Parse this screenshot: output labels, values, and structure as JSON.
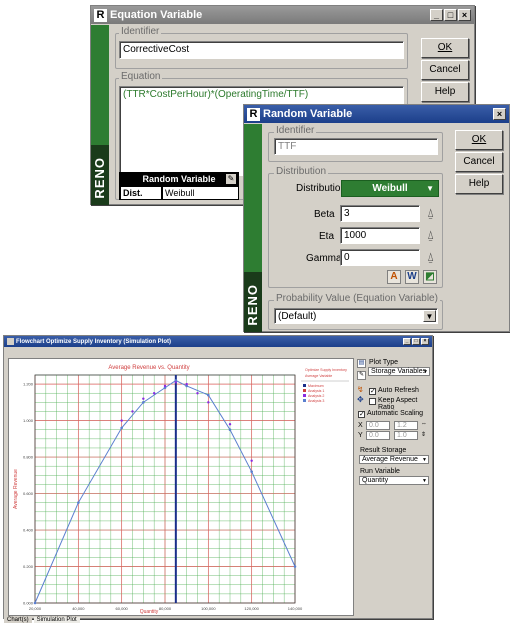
{
  "equation_window": {
    "title": "Equation Variable",
    "brand": "RENO",
    "identifier_label": "Identifier",
    "identifier_value": "CorrectiveCost",
    "equation_label": "Equation",
    "equation_value": "(TTR*CostPerHour)*(OperatingTime/TTF)",
    "ok_label": "OK",
    "cancel_label": "Cancel",
    "help_label": "Help",
    "rv_panel": {
      "title": "Random Variable",
      "dist_label": "Dist.",
      "dist_value": "Weibull"
    }
  },
  "random_window": {
    "title": "Random Variable",
    "brand": "RENO",
    "identifier_label": "Identifier",
    "identifier_value": "TTF",
    "distribution_group": "Distribution",
    "distribution_label": "Distribution",
    "distribution_value": "Weibull",
    "beta_label": "Beta",
    "beta_value": "3",
    "eta_label": "Eta",
    "eta_value": "1000",
    "gamma_label": "Gamma",
    "gamma_value": "0",
    "probability_group": "Probability Value (Equation Variable)",
    "probability_value": "(Default)",
    "ok_label": "OK",
    "cancel_label": "Cancel",
    "help_label": "Help"
  },
  "chart_window": {
    "title": "Flowchart Optimize Supply Inventory (Simulation Plot)",
    "panel": {
      "plot_type_label": "Plot Type",
      "plot_type_value": "Storage Variables",
      "auto_refresh_label": "Auto Refresh",
      "keep_aspect_label": "Keep Aspect Ratio",
      "auto_scaling_label": "Automatic Scaling",
      "x_label": "X",
      "y_label": "Y",
      "x_min": "0.0",
      "x_max": "1.2",
      "y_min": "0.0",
      "y_max": "1.0",
      "result_storage_label": "Result Storage",
      "result_storage_value": "Average Revenue",
      "run_variable_label": "Run Variable",
      "run_variable_value": "Quantity"
    },
    "tabs": [
      "Chart(s)",
      "Simulation Plot"
    ]
  },
  "chart_data": {
    "type": "line",
    "title": "Average Revenue vs. Quantity",
    "xlabel": "Quantity",
    "ylabel": "Average Revenue",
    "x_ticks": [
      "20,000",
      "40,000",
      "60,000",
      "80,000",
      "100,000",
      "120,000",
      "140,000"
    ],
    "y_ticks": [
      "0.000",
      "0.200",
      "0.400",
      "0.600",
      "0.800",
      "1.000",
      "1.200"
    ],
    "xlim": [
      20000,
      140000
    ],
    "ylim": [
      0,
      1.25
    ],
    "legend": {
      "header": [
        "Optimize Supply Inventory",
        "Average Variable"
      ],
      "items": [
        "Maximum",
        "Analysis 1",
        "Analysis 2",
        "Analysis 3"
      ]
    },
    "series": [
      {
        "name": "Average Revenue",
        "x": [
          20000,
          40000,
          60000,
          70000,
          80000,
          85000,
          90000,
          100000,
          110000,
          120000,
          140000
        ],
        "y": [
          0.0,
          0.55,
          0.96,
          1.1,
          1.18,
          1.22,
          1.19,
          1.14,
          0.95,
          0.72,
          0.2
        ]
      }
    ],
    "scatter": [
      {
        "x": 60000,
        "y": 1.0
      },
      {
        "x": 65000,
        "y": 1.05
      },
      {
        "x": 70000,
        "y": 1.12
      },
      {
        "x": 75000,
        "y": 1.15
      },
      {
        "x": 80000,
        "y": 1.19
      },
      {
        "x": 85000,
        "y": 1.21
      },
      {
        "x": 90000,
        "y": 1.2
      },
      {
        "x": 95000,
        "y": 1.15
      },
      {
        "x": 100000,
        "y": 1.1
      },
      {
        "x": 110000,
        "y": 0.98
      },
      {
        "x": 120000,
        "y": 0.78
      }
    ],
    "max_x": 85000,
    "colors": {
      "line": "#5b7fcf",
      "points": "#8a2be2",
      "major_grid": "#e06060",
      "minor_grid": "#4caf50",
      "max_line": "#1a2e8a"
    }
  }
}
